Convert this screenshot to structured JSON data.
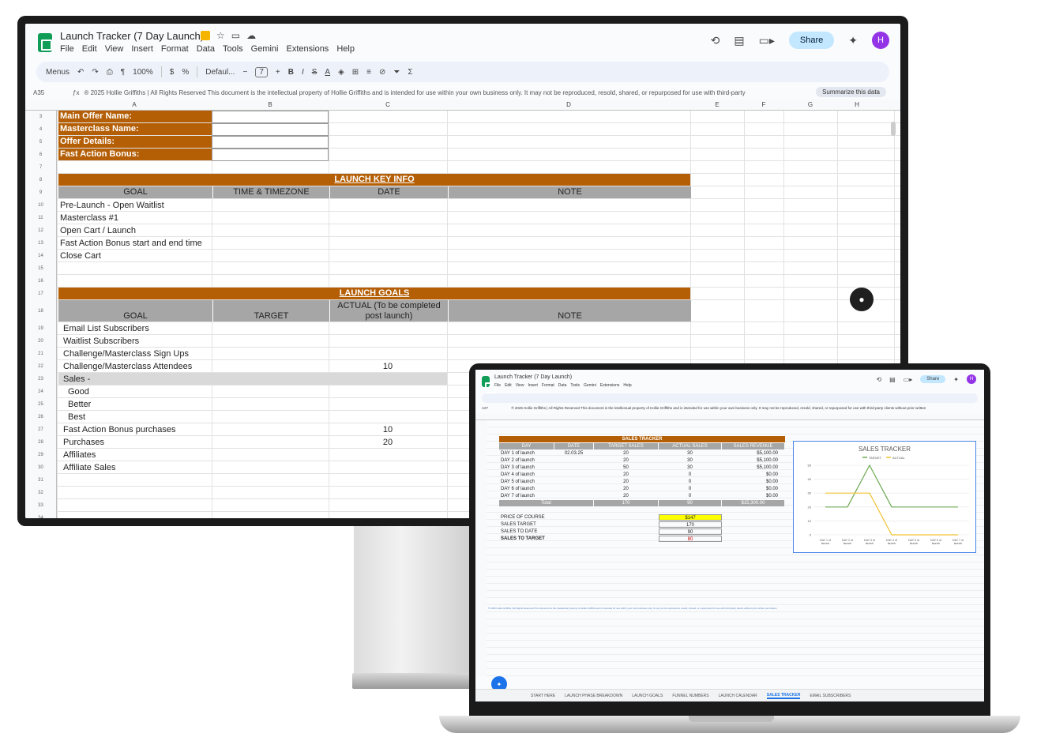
{
  "monitor": {
    "title": "Launch Tracker (7 Day Launch)",
    "menu": [
      "File",
      "Edit",
      "View",
      "Insert",
      "Format",
      "Data",
      "Tools",
      "Gemini",
      "Extensions",
      "Help"
    ],
    "share_label": "Share",
    "avatar_letter": "H",
    "toolbar": {
      "search": "Menus",
      "zoom": "100%",
      "font": "Defaul...",
      "size": "7"
    },
    "cell_ref": "A35",
    "formula": "® 2025 Hollie Griffiths | All Rights Reserved This document is the intellectual property of Hollie Griffiths and is intended for use within your own business only. It may not be reproduced, resold, shared, or repurposed for use with third-party",
    "summarize": "Summarize this data",
    "columns": [
      "A",
      "B",
      "C",
      "D",
      "E",
      "F",
      "G",
      "H"
    ],
    "offer_labels": [
      "Main Offer Name:",
      "Masterclass Name:",
      "Offer Details:",
      "Fast Action Bonus:"
    ],
    "key_info": {
      "title": "LAUNCH KEY INFO",
      "headers": [
        "GOAL",
        "TIME & TIMEZONE",
        "DATE",
        "NOTE"
      ],
      "rows": [
        "Pre-Launch - Open Waitlist",
        "Masterclass #1",
        "Open Cart / Launch",
        "Fast Action Bonus start and end time",
        "Close Cart"
      ]
    },
    "goals": {
      "title": "LAUNCH GOALS",
      "headers": [
        "GOAL",
        "TARGET",
        "ACTUAL (To be completed post launch)",
        "NOTE"
      ],
      "rows": [
        {
          "label": "Email List Subscribers",
          "actual": ""
        },
        {
          "label": "Waitlist Subscribers",
          "actual": ""
        },
        {
          "label": "Challenge/Masterclass Sign Ups",
          "actual": ""
        },
        {
          "label": "Challenge/Masterclass Attendees",
          "actual": "10"
        },
        {
          "label": "Sales -",
          "actual": ""
        },
        {
          "label": "Good",
          "actual": ""
        },
        {
          "label": "Better",
          "actual": ""
        },
        {
          "label": "Best",
          "actual": ""
        },
        {
          "label": "Fast Action Bonus purchases",
          "actual": "10"
        },
        {
          "label": "Purchases",
          "actual": "20"
        },
        {
          "label": "Affiliates",
          "actual": ""
        },
        {
          "label": "Affiliate Sales",
          "actual": ""
        }
      ]
    },
    "row_numbers": [
      "3",
      "4",
      "5",
      "6",
      "7",
      "8",
      "9",
      "10",
      "11",
      "12",
      "13",
      "14",
      "15",
      "16",
      "17",
      "18",
      "19",
      "20",
      "21",
      "22",
      "23",
      "24",
      "25",
      "26",
      "27",
      "28",
      "29",
      "30",
      "31",
      "32",
      "33",
      "34"
    ]
  },
  "laptop": {
    "title": "Launch Tracker (7 Day Launch)",
    "menu": [
      "File",
      "Edit",
      "View",
      "Insert",
      "Format",
      "Data",
      "Tools",
      "Gemini",
      "Extensions",
      "Help"
    ],
    "share_label": "Share",
    "avatar_letter": "H",
    "cell_ref": "A27",
    "formula": "® 2025 Hollie Griffiths | All Rights Reserved This document is the intellectual property of Hollie Griffiths and is intended for use within your own business only. It may not be reproduced, resold, shared, or repurposed for use with third-party clients without prior written",
    "table_title": "SALES TRACKER",
    "headers": [
      "DAY",
      "DATE",
      "TARGET SALES",
      "ACTUAL SALES",
      "SALES REVENUE"
    ],
    "rows": [
      {
        "day": "DAY 1 of launch",
        "date": "02.03.25",
        "target": "20",
        "actual": "30",
        "revenue": "$5,100.00"
      },
      {
        "day": "DAY 2 of launch",
        "date": "",
        "target": "20",
        "actual": "30",
        "revenue": "$5,100.00"
      },
      {
        "day": "DAY 3 of launch",
        "date": "",
        "target": "50",
        "actual": "30",
        "revenue": "$5,100.00"
      },
      {
        "day": "DAY 4 of launch",
        "date": "",
        "target": "20",
        "actual": "0",
        "revenue": "$0.00"
      },
      {
        "day": "DAY 5 of launch",
        "date": "",
        "target": "20",
        "actual": "0",
        "revenue": "$0.00"
      },
      {
        "day": "DAY 6 of launch",
        "date": "",
        "target": "20",
        "actual": "0",
        "revenue": "$0.00"
      },
      {
        "day": "DAY 7 of launch",
        "date": "",
        "target": "20",
        "actual": "0",
        "revenue": "$0.00"
      }
    ],
    "total": {
      "label": "Total",
      "target": "170",
      "actual": "90",
      "revenue": "$15,300.00"
    },
    "summary": [
      {
        "label": "PRICE OF COURSE",
        "value": "$147"
      },
      {
        "label": "SALES TARGET",
        "value": "170"
      },
      {
        "label": "SALES TO DATE",
        "value": "90"
      },
      {
        "label": "SALES TO TARGET",
        "value": "80"
      }
    ],
    "tabs": [
      "START HERE",
      "LAUNCH PHASE BREAKDOWN",
      "LAUNCH GOALS",
      "FUNNEL NUMBERS",
      "LAUNCH CALENDAR",
      "SALES TRACKER",
      "EMAIL SUBSCRIBERS"
    ],
    "active_tab": "SALES TRACKER",
    "footer_text": "® 2025 Hollie Griffiths | All Rights Reserved This document is the intellectual property of Hollie Griffiths and is intended for use within your own business only. It may not be reproduced, resold, shared, or repurposed for use with third-party clients without prior written permission."
  },
  "colors": {
    "orange": "#b45f06",
    "gray": "#a6a6a6",
    "target": "#6aa84f",
    "actual": "#f1c232",
    "accent": "#1a73e8"
  },
  "chart_data": {
    "type": "line",
    "title": "SALES TRACKER",
    "categories": [
      "DAY 1 of launch",
      "DAY 2 of launch",
      "DAY 3 of launch",
      "DAY 4 of launch",
      "DAY 5 of launch",
      "DAY 6 of launch",
      "DAY 7 of launch"
    ],
    "series": [
      {
        "name": "TARGET",
        "values": [
          20,
          20,
          50,
          20,
          20,
          20,
          20
        ],
        "color": "#6aa84f"
      },
      {
        "name": "ACTUAL",
        "values": [
          30,
          30,
          30,
          0,
          0,
          0,
          0
        ],
        "color": "#f1c232"
      }
    ],
    "ylim": [
      0,
      50
    ],
    "yticks": [
      "0",
      "10",
      "20",
      "30",
      "40",
      "50"
    ],
    "legend": "top",
    "grid": true
  }
}
